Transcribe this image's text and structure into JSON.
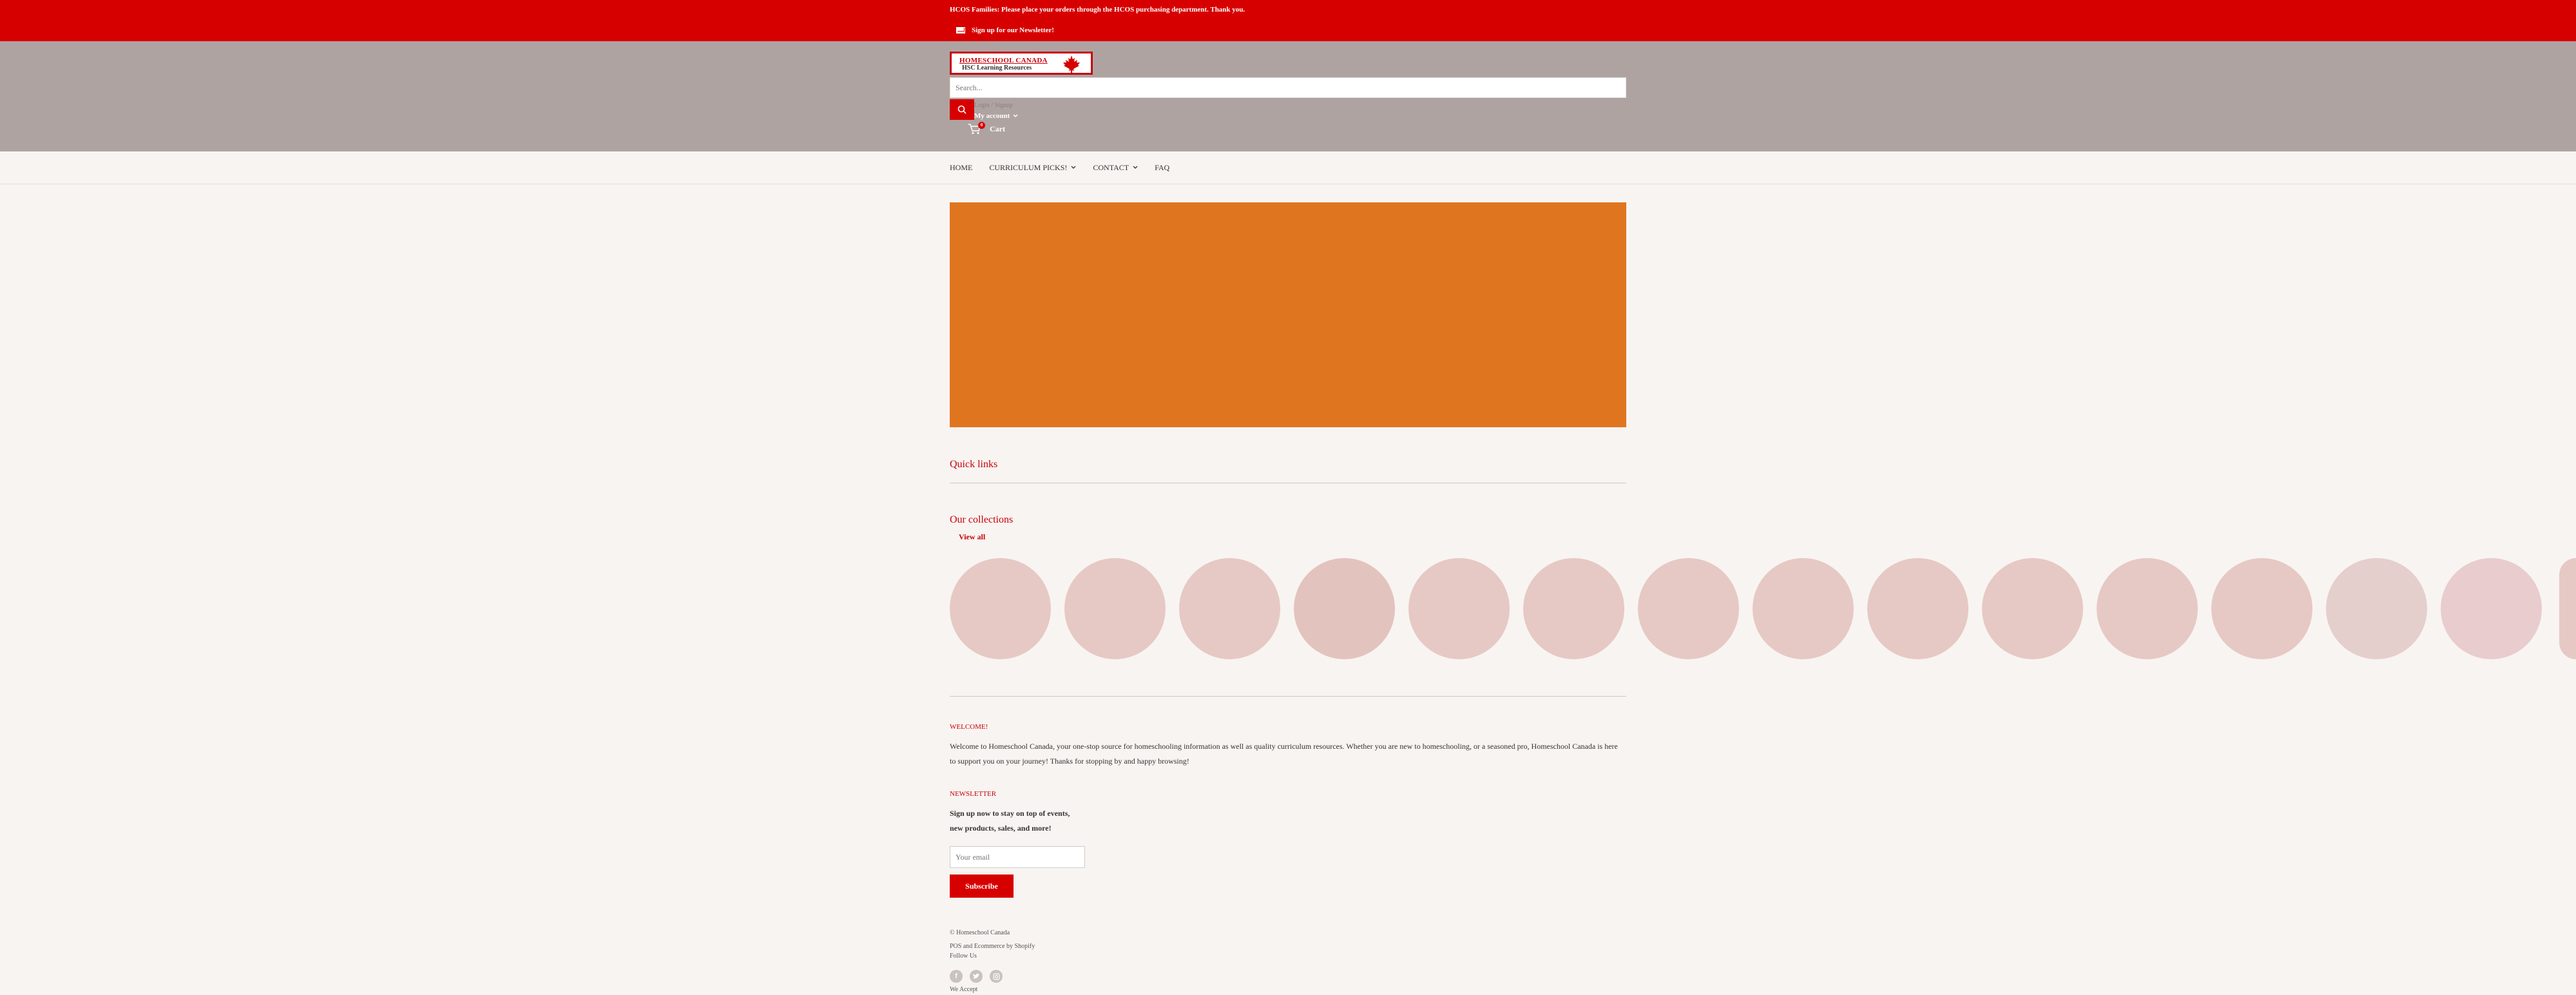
{
  "announcement": {
    "message": "HCOS Families: Please place your orders through the HCOS purchasing department. Thank you.",
    "newsletter_link": "Sign up for our Newsletter!"
  },
  "header": {
    "logo_line1": "HOMESCHOOL CANADA",
    "logo_line2": "HSC Learning Resources",
    "search_placeholder": "Search...",
    "login_label": "Login / Signup",
    "account_label": "My account",
    "cart_label": "Cart",
    "cart_count": "0"
  },
  "nav": {
    "items": [
      {
        "label": "HOME"
      },
      {
        "label": "CURRICULUM PICKS!"
      },
      {
        "label": "CONTACT"
      },
      {
        "label": "FAQ"
      }
    ]
  },
  "sections": {
    "quick_links": "Quick links",
    "collections_title": "Our collections",
    "view_all": "View all"
  },
  "welcome": {
    "title": "WELCOME!",
    "text": "Welcome to Homeschool Canada, your one-stop source for homeschooling information as well as quality curriculum resources. Whether you are new to homeschooling, or a seasoned pro, Homeschool Canada is here to support you on your journey! Thanks for stopping by and happy browsing!"
  },
  "newsletter": {
    "title": "NEWSLETTER",
    "text": "Sign up now to stay on top of events,\nnew products, sales, and more!",
    "email_placeholder": "Your email",
    "subscribe_label": "Subscribe"
  },
  "footer": {
    "copyright": "© Homeschool Canada",
    "powered": "POS and Ecommerce by Shopify",
    "follow": "Follow Us",
    "we_accept": "We Accept"
  },
  "colors": {
    "accent_red": "#d70000",
    "header_bg": "#afa3a2",
    "hero_orange": "#e0751f",
    "collection_placeholder": "#e6c9c4"
  },
  "icons": [
    "mail-icon",
    "maple-leaf-icon",
    "search-icon",
    "chevron-down-icon",
    "cart-icon",
    "facebook-icon",
    "twitter-icon",
    "instagram-icon"
  ]
}
